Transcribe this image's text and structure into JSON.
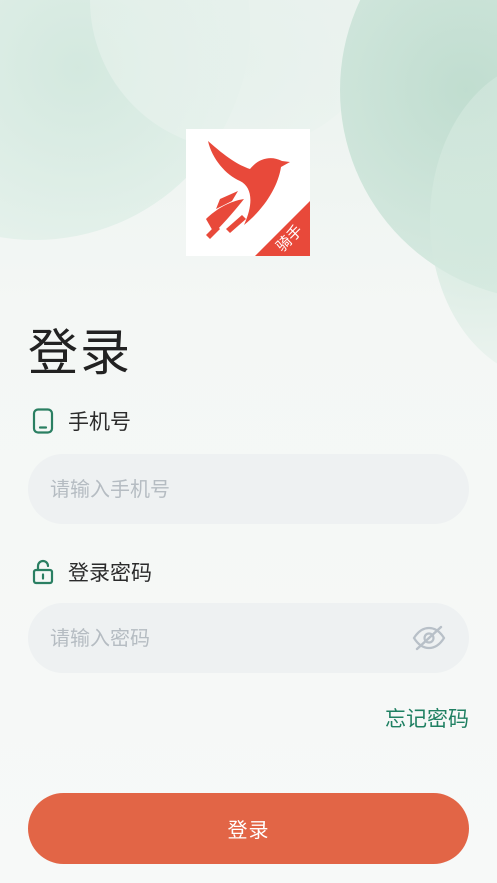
{
  "app": {
    "logo_badge": "骑手"
  },
  "title": "登录",
  "phone": {
    "label": "手机号",
    "placeholder": "请输入手机号",
    "value": ""
  },
  "password": {
    "label": "登录密码",
    "placeholder": "请输入密码",
    "value": ""
  },
  "links": {
    "forgot_password": "忘记密码"
  },
  "actions": {
    "login_label": "登录"
  },
  "colors": {
    "brand_red": "#e26546",
    "logo_red": "#e8493a",
    "accent_green": "#1f8062",
    "icon_green": "#2a7f62",
    "input_bg": "#eef1f2",
    "placeholder": "#b5bcc2"
  },
  "icons": {
    "phone": "phone-icon",
    "lock": "unlock-icon",
    "eye": "eye-off-icon"
  }
}
